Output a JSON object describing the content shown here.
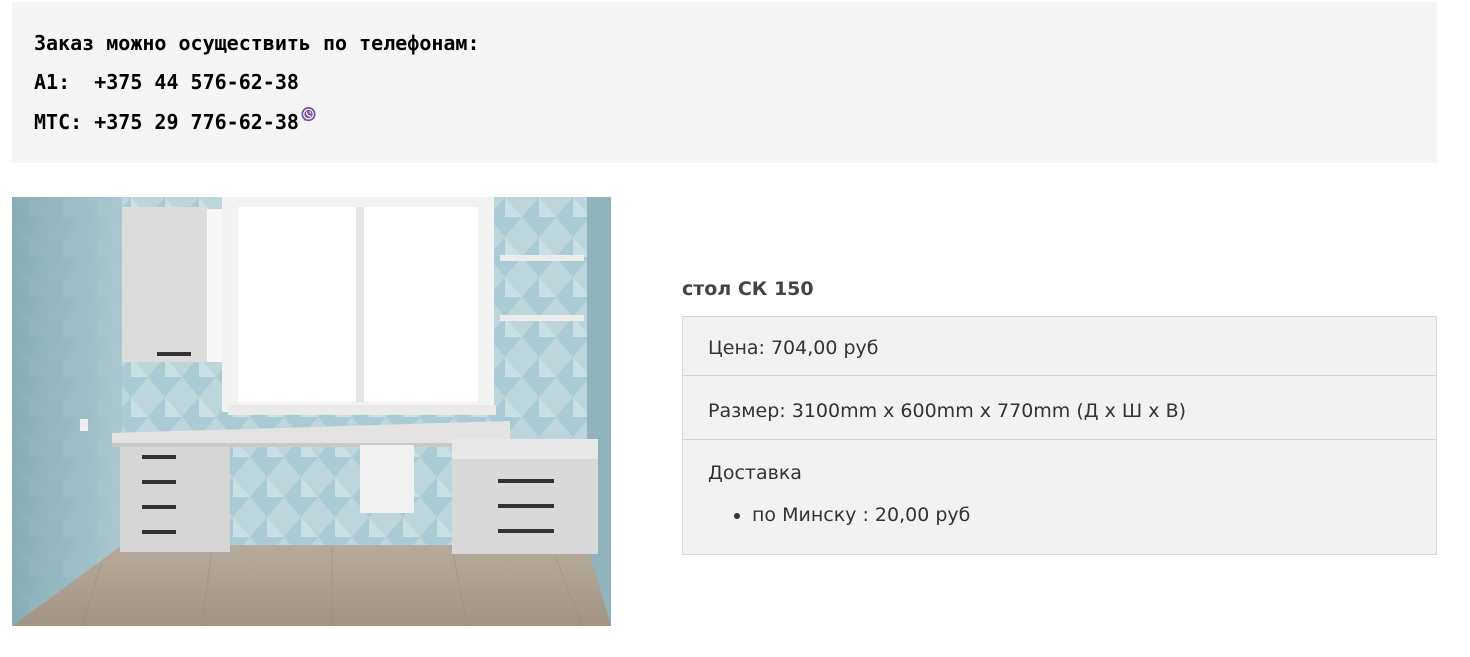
{
  "contacts": {
    "heading": "Заказ можно осуществить по телефонам:",
    "a1_line": "А1:  +375 44 576-62-38",
    "mts_line": "МТС: +375 29 776-62-38",
    "viber_icon": "viber-icon",
    "viber_color": "#7b519d"
  },
  "product": {
    "title": "стол СК 150",
    "price": "Цена: 704,00 руб",
    "size": "Размер:  3100mm x 600mm x 770mm (Д х Ш х В)",
    "delivery_label": "Доставка",
    "delivery_items": [
      "по Минску : 20,00 руб"
    ]
  }
}
